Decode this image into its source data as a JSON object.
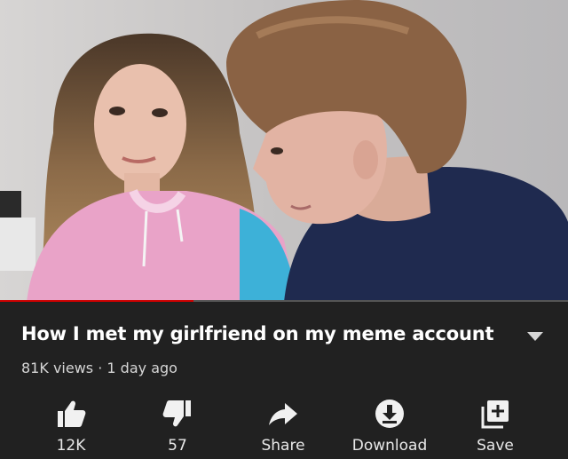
{
  "video": {
    "title": "How I met my girlfriend on my meme account",
    "views": "81K views",
    "separator": "·",
    "age": "1 day ago",
    "progress": 0.34
  },
  "actions": [
    {
      "name": "like-button",
      "icon": "thumbs-up-icon",
      "label": "12K"
    },
    {
      "name": "dislike-button",
      "icon": "thumbs-down-icon",
      "label": "57"
    },
    {
      "name": "share-button",
      "icon": "share-arrow-icon",
      "label": "Share"
    },
    {
      "name": "download-button",
      "icon": "download-icon",
      "label": "Download"
    },
    {
      "name": "save-button",
      "icon": "add-to-playlist-icon",
      "label": "Save"
    }
  ],
  "colors": {
    "background": "#212121",
    "progress": "#cc0000",
    "text": "#ffffff",
    "secondary_text": "#d6d6d6"
  }
}
